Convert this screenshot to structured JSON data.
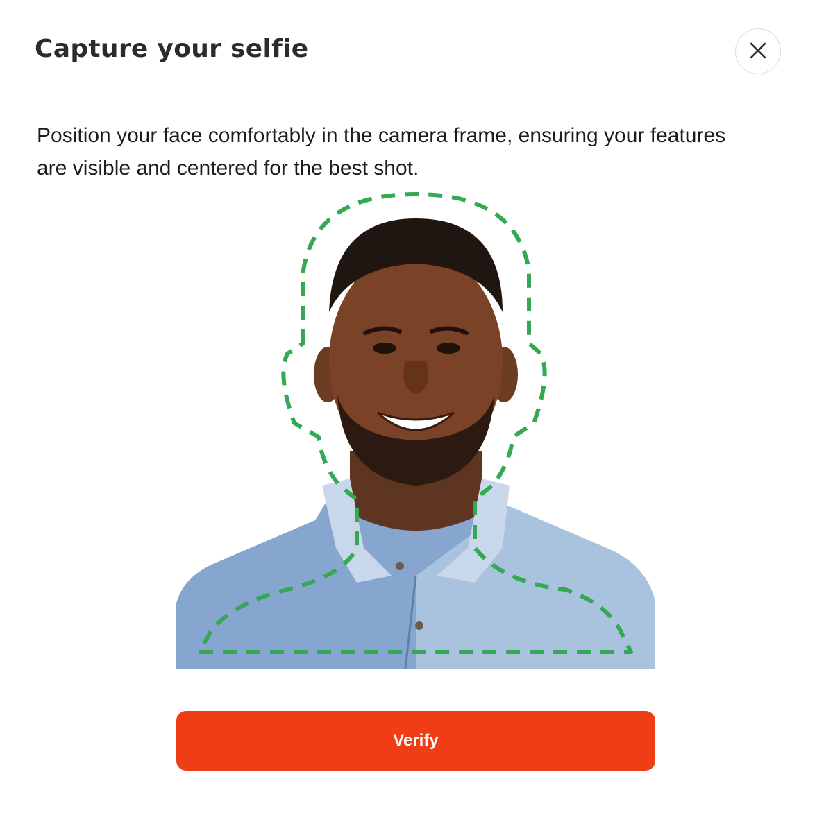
{
  "dialog": {
    "title": "Capture your selfie",
    "close_icon": "close-icon",
    "instructions": "Position your face comfortably in the camera frame, ensuring your features are visible and centered for the best shot."
  },
  "camera": {
    "guide_icon": "face-outline-guide",
    "guide_color": "#34a853"
  },
  "actions": {
    "verify_label": "Verify",
    "verify_color": "#ef3e16"
  }
}
